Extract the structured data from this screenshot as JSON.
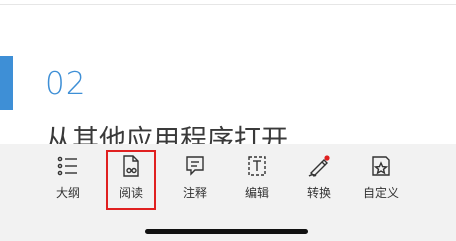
{
  "document": {
    "section_number": "02",
    "heading": "从其他应用程序打开",
    "accent_color": "#3e8fd6"
  },
  "toolbar": {
    "items": [
      {
        "id": "outline",
        "label": "大纲",
        "icon": "list-icon"
      },
      {
        "id": "read",
        "label": "阅读",
        "icon": "read-document-icon",
        "selected": true
      },
      {
        "id": "annotate",
        "label": "注释",
        "icon": "comment-icon"
      },
      {
        "id": "edit",
        "label": "编辑",
        "icon": "text-edit-icon"
      },
      {
        "id": "convert",
        "label": "转换",
        "icon": "pen-convert-icon",
        "badge": "red-dot"
      },
      {
        "id": "customize",
        "label": "自定义",
        "icon": "custom-star-icon"
      }
    ],
    "selected_outline_color": "#e02020"
  }
}
